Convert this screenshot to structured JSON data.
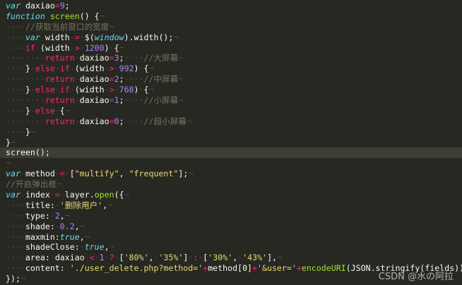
{
  "editor": {
    "theme": {
      "background": "#272822",
      "current_line": "#3e3d32",
      "keyword": "#66d9ef",
      "control": "#f92672",
      "function": "#a6e22e",
      "number": "#ae81ff",
      "string": "#e6db74",
      "comment": "#75715e",
      "whitespace": "#4b4b3f"
    },
    "lines": [
      [
        [
          "kw",
          "var"
        ],
        [
          "sp",
          " "
        ],
        [
          "p",
          "daxiao"
        ],
        [
          "op",
          "="
        ],
        [
          "num",
          "9"
        ],
        [
          "p",
          ";"
        ]
      ],
      [
        [
          "kw",
          "function"
        ],
        [
          "sp",
          " "
        ],
        [
          "fn",
          "screen"
        ],
        [
          "p",
          "()"
        ],
        [
          "sp",
          " "
        ],
        [
          "p",
          "{"
        ],
        [
          "ws",
          "¬"
        ]
      ],
      [
        [
          "ws",
          "····"
        ],
        [
          "cm",
          "//获取当前窗口的宽度"
        ],
        [
          "ws",
          "¬"
        ]
      ],
      [
        [
          "ws",
          "····"
        ],
        [
          "kw",
          "var"
        ],
        [
          "sp",
          " "
        ],
        [
          "p",
          "width"
        ],
        [
          "ws",
          "·"
        ],
        [
          "op",
          "="
        ],
        [
          "ws",
          "·"
        ],
        [
          "p",
          "$("
        ],
        [
          "kw",
          "window"
        ],
        [
          "p",
          ").width();"
        ],
        [
          "ws",
          "¬"
        ]
      ],
      [
        [
          "ws",
          "····"
        ],
        [
          "ctl",
          "if"
        ],
        [
          "ws",
          "·"
        ],
        [
          "p",
          "(width"
        ],
        [
          "ws",
          "·"
        ],
        [
          "op",
          ">"
        ],
        [
          "ws",
          "·"
        ],
        [
          "num",
          "1200"
        ],
        [
          "p",
          ")"
        ],
        [
          "ws",
          "·"
        ],
        [
          "p",
          "{"
        ],
        [
          "ws",
          "¬"
        ]
      ],
      [
        [
          "ws",
          "········"
        ],
        [
          "ctl",
          "return"
        ],
        [
          "ws",
          "·"
        ],
        [
          "p",
          "daxiao"
        ],
        [
          "op",
          "="
        ],
        [
          "num",
          "3"
        ],
        [
          "p",
          ";"
        ],
        [
          "ws",
          "····"
        ],
        [
          "cm",
          "//大屏幕"
        ],
        [
          "ws",
          "¬"
        ]
      ],
      [
        [
          "ws",
          "····"
        ],
        [
          "p",
          "}"
        ],
        [
          "ws",
          "·"
        ],
        [
          "ctl",
          "else"
        ],
        [
          "ws",
          "·"
        ],
        [
          "ctl",
          "if"
        ],
        [
          "ws",
          "·"
        ],
        [
          "p",
          "(width"
        ],
        [
          "ws",
          "·"
        ],
        [
          "op",
          ">"
        ],
        [
          "ws",
          "·"
        ],
        [
          "num",
          "992"
        ],
        [
          "p",
          ")"
        ],
        [
          "ws",
          "·"
        ],
        [
          "p",
          "{"
        ],
        [
          "ws",
          "¬"
        ]
      ],
      [
        [
          "ws",
          "········"
        ],
        [
          "ctl",
          "return"
        ],
        [
          "ws",
          "·"
        ],
        [
          "p",
          "daxiao"
        ],
        [
          "op",
          "="
        ],
        [
          "num",
          "2"
        ],
        [
          "p",
          ";"
        ],
        [
          "ws",
          "····"
        ],
        [
          "cm",
          "//中屏幕"
        ],
        [
          "ws",
          "¬"
        ]
      ],
      [
        [
          "ws",
          "····"
        ],
        [
          "p",
          "}"
        ],
        [
          "ws",
          "·"
        ],
        [
          "ctl",
          "else"
        ],
        [
          "ws",
          "·"
        ],
        [
          "ctl",
          "if"
        ],
        [
          "ws",
          "·"
        ],
        [
          "p",
          "(width"
        ],
        [
          "ws",
          "·"
        ],
        [
          "op",
          ">"
        ],
        [
          "ws",
          "·"
        ],
        [
          "num",
          "768"
        ],
        [
          "p",
          ")"
        ],
        [
          "ws",
          "·"
        ],
        [
          "p",
          "{"
        ],
        [
          "ws",
          "¬"
        ]
      ],
      [
        [
          "ws",
          "········"
        ],
        [
          "ctl",
          "return"
        ],
        [
          "ws",
          "·"
        ],
        [
          "p",
          "daxiao"
        ],
        [
          "op",
          "="
        ],
        [
          "num",
          "1"
        ],
        [
          "p",
          ";"
        ],
        [
          "ws",
          "····"
        ],
        [
          "cm",
          "//小屏幕"
        ],
        [
          "ws",
          "¬"
        ]
      ],
      [
        [
          "ws",
          "····"
        ],
        [
          "p",
          "}"
        ],
        [
          "ws",
          "·"
        ],
        [
          "ctl",
          "else"
        ],
        [
          "ws",
          "·"
        ],
        [
          "p",
          "{"
        ],
        [
          "ws",
          "¬"
        ]
      ],
      [
        [
          "ws",
          "········"
        ],
        [
          "ctl",
          "return"
        ],
        [
          "ws",
          "·"
        ],
        [
          "p",
          "daxiao"
        ],
        [
          "op",
          "="
        ],
        [
          "num",
          "0"
        ],
        [
          "p",
          ";"
        ],
        [
          "ws",
          "····"
        ],
        [
          "cm",
          "//超小屏幕"
        ],
        [
          "ws",
          "¬"
        ]
      ],
      [
        [
          "ws",
          "····"
        ],
        [
          "p",
          "}"
        ],
        [
          "ws",
          "¬"
        ]
      ],
      [
        [
          "p",
          "}"
        ],
        [
          "ws",
          "¬"
        ]
      ],
      [
        [
          "p",
          "screen();"
        ],
        [
          "ws",
          "¬"
        ]
      ],
      [
        [
          "ws",
          "¬"
        ]
      ],
      [
        [
          "kw",
          "var"
        ],
        [
          "sp",
          " "
        ],
        [
          "p",
          "method"
        ],
        [
          "ws",
          "·"
        ],
        [
          "op",
          "="
        ],
        [
          "ws",
          "·"
        ],
        [
          "p",
          "["
        ],
        [
          "str",
          "\"multify\""
        ],
        [
          "p",
          ","
        ],
        [
          "ws",
          "·"
        ],
        [
          "str",
          "\"frequent\""
        ],
        [
          "p",
          "];"
        ],
        [
          "ws",
          "¬"
        ]
      ],
      [
        [
          "cm",
          "//开启弹出框"
        ],
        [
          "ws",
          "¬"
        ]
      ],
      [
        [
          "kw",
          "var"
        ],
        [
          "sp",
          " "
        ],
        [
          "p",
          "index"
        ],
        [
          "ws",
          "·"
        ],
        [
          "op",
          "="
        ],
        [
          "ws",
          "·"
        ],
        [
          "p",
          "layer."
        ],
        [
          "fn",
          "open"
        ],
        [
          "p",
          "({"
        ],
        [
          "ws",
          "¬"
        ]
      ],
      [
        [
          "ws",
          "····"
        ],
        [
          "p",
          "title:"
        ],
        [
          "ws",
          "·"
        ],
        [
          "str",
          "'删除用户'"
        ],
        [
          "p",
          ","
        ],
        [
          "ws",
          "¬"
        ]
      ],
      [
        [
          "ws",
          "····"
        ],
        [
          "p",
          "type:"
        ],
        [
          "ws",
          "·"
        ],
        [
          "num",
          "2"
        ],
        [
          "p",
          ","
        ],
        [
          "ws",
          "¬"
        ]
      ],
      [
        [
          "ws",
          "····"
        ],
        [
          "p",
          "shade:"
        ],
        [
          "ws",
          "·"
        ],
        [
          "num",
          "0.2"
        ],
        [
          "p",
          ","
        ],
        [
          "ws",
          "¬"
        ]
      ],
      [
        [
          "ws",
          "····"
        ],
        [
          "p",
          "maxmin:"
        ],
        [
          "kw",
          "true"
        ],
        [
          "p",
          ","
        ],
        [
          "ws",
          "¬"
        ]
      ],
      [
        [
          "ws",
          "····"
        ],
        [
          "p",
          "shadeClose:"
        ],
        [
          "ws",
          "·"
        ],
        [
          "kw",
          "true"
        ],
        [
          "p",
          ","
        ],
        [
          "ws",
          "¬"
        ]
      ],
      [
        [
          "ws",
          "····"
        ],
        [
          "p",
          "area:"
        ],
        [
          "ws",
          "·"
        ],
        [
          "p",
          "daxiao"
        ],
        [
          "ws",
          "·"
        ],
        [
          "op",
          "<"
        ],
        [
          "ws",
          "·"
        ],
        [
          "num",
          "1"
        ],
        [
          "ws",
          "·"
        ],
        [
          "op",
          "?"
        ],
        [
          "ws",
          "·"
        ],
        [
          "p",
          "["
        ],
        [
          "str",
          "'80%'"
        ],
        [
          "p",
          ","
        ],
        [
          "ws",
          "·"
        ],
        [
          "str",
          "'35%'"
        ],
        [
          "p",
          "]"
        ],
        [
          "ws",
          "·"
        ],
        [
          "op",
          ":"
        ],
        [
          "ws",
          "·"
        ],
        [
          "p",
          "["
        ],
        [
          "str",
          "'30%'"
        ],
        [
          "p",
          ","
        ],
        [
          "ws",
          "·"
        ],
        [
          "str",
          "'43%'"
        ],
        [
          "p",
          "],"
        ],
        [
          "ws",
          "¬"
        ]
      ],
      [
        [
          "ws",
          "····"
        ],
        [
          "p",
          "content:"
        ],
        [
          "ws",
          "·"
        ],
        [
          "str",
          "'./user_delete.php?method='"
        ],
        [
          "op",
          "+"
        ],
        [
          "p",
          "method[0]"
        ],
        [
          "op",
          "+"
        ],
        [
          "str",
          "'&user='"
        ],
        [
          "op",
          "+"
        ],
        [
          "fn",
          "encodeURI"
        ],
        [
          "p",
          "(JSON.stringify(fields)),"
        ]
      ],
      [
        [
          "p",
          "});"
        ],
        [
          "ws",
          "¬"
        ]
      ]
    ],
    "current_line_index": 14
  },
  "watermark": {
    "text": "CSDN @水の阿拉"
  }
}
